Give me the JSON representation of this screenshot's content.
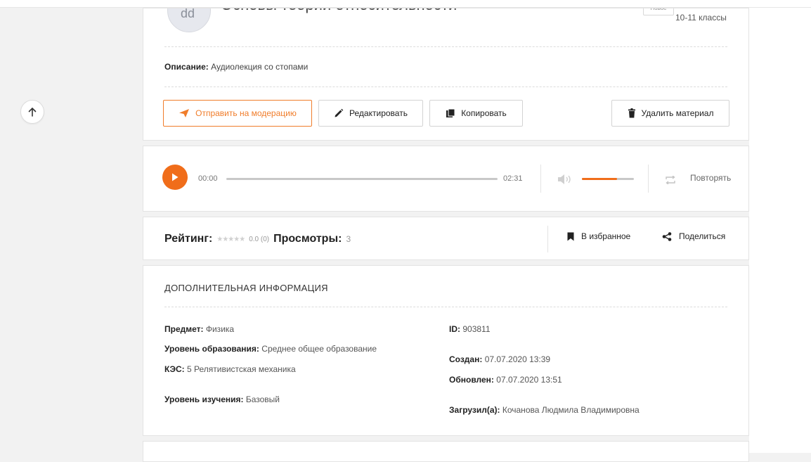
{
  "header": {
    "avatar_glyph": "dd",
    "title": "Основы теории относительности",
    "badge": "Новое",
    "grade": "10-11 классы"
  },
  "description": {
    "label": "Описание:",
    "value": "Аудиолекция со стопами"
  },
  "actions": {
    "moderate": "Отправить на модерацию",
    "edit": "Редактировать",
    "copy": "Копировать",
    "delete": "Удалить материал"
  },
  "player": {
    "current_time": "00:00",
    "duration": "02:31",
    "progress": 0,
    "volume": 0.68,
    "repeat_label": "Повторять"
  },
  "stats": {
    "rating_label": "Рейтинг:",
    "rating_value": "0.0 (0)",
    "stars_filled": 0,
    "stars_total": 5,
    "views_label": "Просмотры:",
    "views_value": "3",
    "favorite": "В избранное",
    "share": "Поделиться"
  },
  "details": {
    "title": "ДОПОЛНИТЕЛЬНАЯ ИНФОРМАЦИЯ",
    "subject_label": "Предмет:",
    "subject": "Физика",
    "level_label": "Уровень образования:",
    "level": "Среднее общее образование",
    "kes_label": "КЭС:",
    "kes": "5 Релятивистская механика",
    "study_label": "Уровень изучения:",
    "study": "Базовый",
    "id_label": "ID:",
    "id": "903811",
    "created_label": "Создан:",
    "created": "07.07.2020 13:39",
    "updated_label": "Обновлен:",
    "updated": "07.07.2020 13:51",
    "uploaded_label": "Загрузил(а):",
    "uploaded": "Кочанова Людмила Владимировна"
  },
  "colors": {
    "accent": "#f06d1a",
    "border": "#e3e3e3",
    "background": "#f2f2f2"
  }
}
